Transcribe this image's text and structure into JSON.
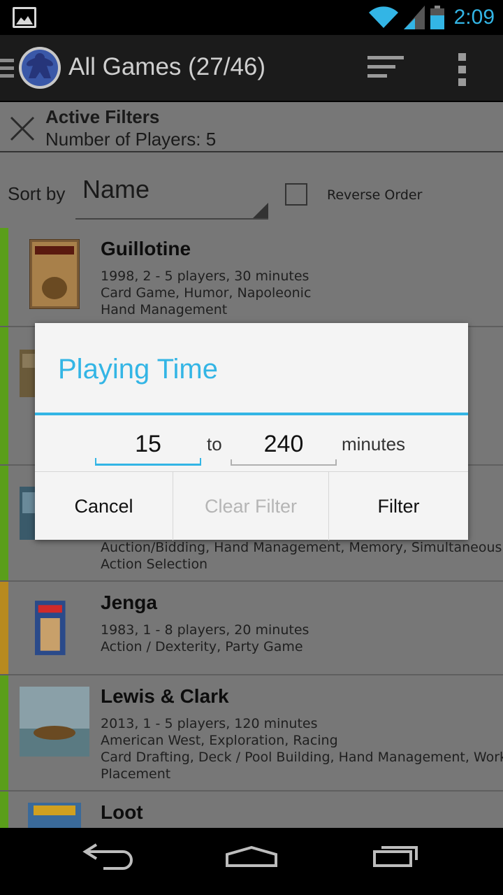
{
  "status_bar": {
    "time": "2:09"
  },
  "action_bar": {
    "title": "All Games (27/46)"
  },
  "filters": {
    "title": "Active Filters",
    "value": "Number of Players: 5"
  },
  "sort": {
    "label": "Sort by",
    "value": "Name",
    "reverse_label": "Reverse Order",
    "reverse_checked": false
  },
  "games": [
    {
      "name": "Guillotine",
      "lines": [
        "1998, 2 - 5 players, 30 minutes",
        "Card Game, Humor, Napoleonic",
        "Hand Management"
      ],
      "color": "#5a9e1a"
    },
    {
      "name": "",
      "lines": [],
      "color": "#5a9e1a"
    },
    {
      "name": "",
      "lines": [
        "Auction/Bidding, Hand Management, Memory, Simultaneous",
        "Action Selection"
      ],
      "color": "#5a9e1a"
    },
    {
      "name": "Jenga",
      "lines": [
        "1983, 1 - 8 players, 20 minutes",
        "Action / Dexterity, Party Game"
      ],
      "color": "#b88a1f"
    },
    {
      "name": "Lewis & Clark",
      "lines": [
        "2013, 1 - 5 players, 120 minutes",
        "American West, Exploration, Racing",
        "Card Drafting, Deck / Pool Building, Hand Management, Worker",
        "Placement"
      ],
      "color": "#5a9e1a"
    },
    {
      "name": "Loot",
      "lines": [],
      "color": "#5a9e1a"
    }
  ],
  "dialog": {
    "title": "Playing Time",
    "from_value": "15",
    "separator": "to",
    "to_value": "240",
    "unit": "minutes",
    "cancel_label": "Cancel",
    "clear_label": "Clear Filter",
    "filter_label": "Filter"
  },
  "colors": {
    "accent": "#33b5e5",
    "played_bar": "#5a9e1a",
    "alt_bar": "#b88a1f"
  }
}
